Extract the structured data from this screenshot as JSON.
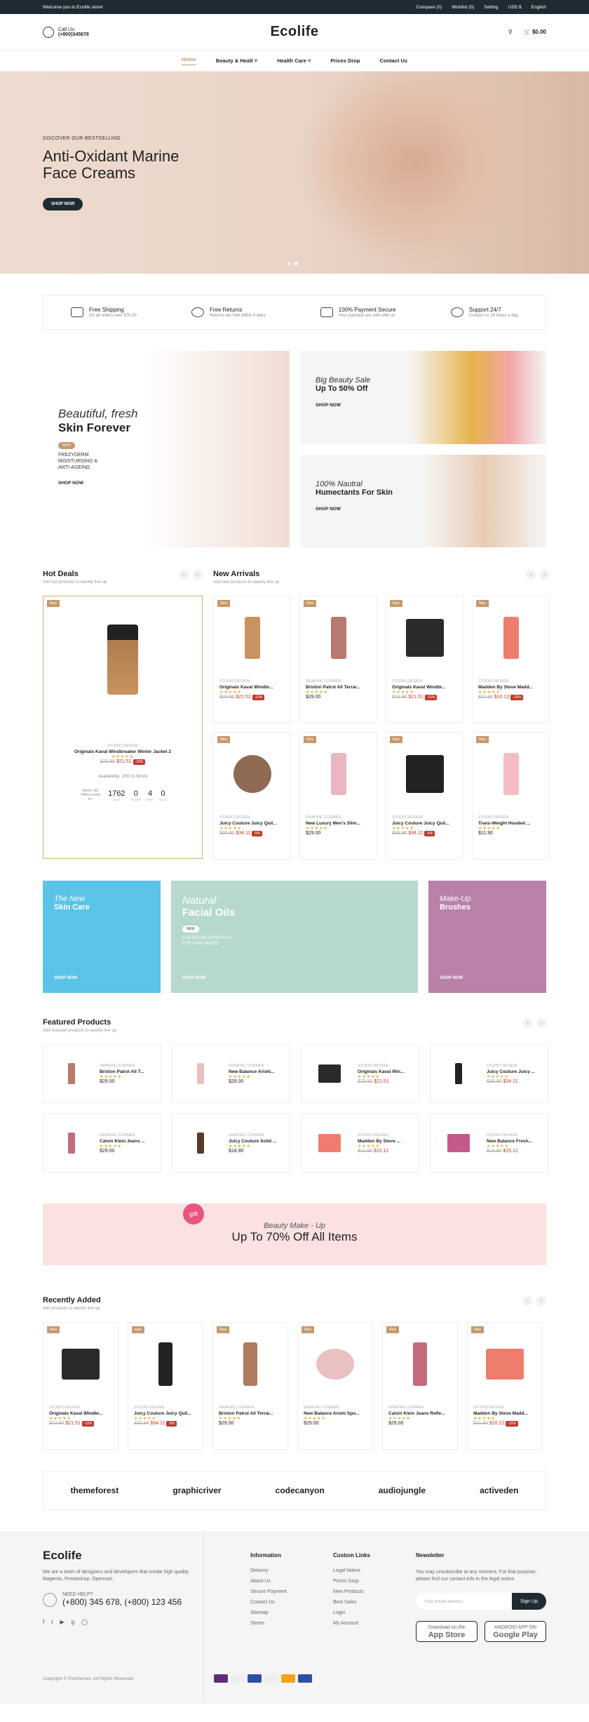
{
  "topbar": {
    "welcome": "Welcome you to Ecolife store!",
    "compare": "Compare (0)",
    "wishlist": "Wishlist (0)",
    "setting": "Setting",
    "currency": "USD $",
    "language": "English"
  },
  "header": {
    "call_label": "Call Us:",
    "phone": "(+800)345678",
    "logo": "Ecolife",
    "cart_total": "$0.00",
    "cart_count": "0"
  },
  "nav": [
    "Home",
    "Beauty & Healt",
    "Health Care",
    "Prices Drop",
    "Contact Us"
  ],
  "hero": {
    "eyebrow": "DISCOVER OUR BESTSELLING",
    "title": "Anti-Oxidant Marine Face Creams",
    "button": "SHOP NOW"
  },
  "features": [
    {
      "title": "Free Shipping",
      "sub": "On all orders over $75.00"
    },
    {
      "title": "Free Returns",
      "sub": "Returns are free within 9 days"
    },
    {
      "title": "100% Payment Secure",
      "sub": "Your payment are safe with us."
    },
    {
      "title": "Support 24/7",
      "sub": "Contact us 24 hours a day"
    }
  ],
  "banners": {
    "big": {
      "italic": "Beautiful, fresh",
      "bold": "Skin Forever",
      "tag": "NEW",
      "lines": [
        "FREZYDERM",
        "MOISTURSING &",
        "ANTI-AGEING"
      ],
      "cta": "SHOP NOW"
    },
    "top": {
      "italic": "Big Beauty Sale",
      "bold": "Up To 50% Off",
      "cta": "SHOP NOW"
    },
    "bottom": {
      "italic": "100% Nautral",
      "bold": "Humectants For Skin",
      "cta": "SHOP NOW"
    }
  },
  "hot_deals": {
    "title": "Hot Deals",
    "sub": "Add hot products to weekly line up",
    "badge": "New",
    "meta": "STUDIO DESIGN",
    "name": "Originals Kaval Windbreaker Winter Jacket 2",
    "old": "$23.90",
    "new": "$21.51",
    "disc": "-10%",
    "availability": "Availability: 200 In Stock",
    "hurry": "Hurry Up! Offers ends in:",
    "days": "1762",
    "hours": "0",
    "mins": "4",
    "secs": "0",
    "l_days": "DAYS",
    "l_hours": "HOURS",
    "l_mins": "MINS",
    "l_secs": "SECS"
  },
  "new_arrivals": {
    "title": "New Arrivals",
    "sub": "Add new products to weekly line up",
    "items": [
      {
        "meta": "STUDIO DESIGN",
        "name": "Originals Kaval Windbr...",
        "old": "$23.90",
        "new": "$21.51",
        "disc": "-10%",
        "color": "#c8935e"
      },
      {
        "meta": "GRAPHIC CORNER",
        "name": "Brixton Patrol All Terrai...",
        "price": "$29.00",
        "color": "#b87a6e"
      },
      {
        "meta": "STUDIO DESIGN",
        "name": "Originals Kaval Windbr...",
        "old": "$23.90",
        "new": "$21.51",
        "disc": "-10%",
        "color": "#2a2a2a"
      },
      {
        "meta": "STUDIO DESIGN",
        "name": "Madden By Steve Madd...",
        "old": "$11.90",
        "new": "$10.12",
        "disc": "-15%",
        "color": "#ee7d6e"
      },
      {
        "meta": "STUDIO DESIGN",
        "name": "Juicy Couture Juicy Quil...",
        "old": "$35.90",
        "new": "$34.11",
        "disc": "-5%",
        "color": "#8f6b53"
      },
      {
        "meta": "GRAPHIC CORNER",
        "name": "New Luxury Men's Slim...",
        "price": "$29.00",
        "color": "#e8b7c2"
      },
      {
        "meta": "STUDIO DESIGN",
        "name": "Juicy Couture Juicy Quil...",
        "old": "$35.90",
        "new": "$34.11",
        "disc": "-5%",
        "color": "#222"
      },
      {
        "meta": "STUDIO DESIGN",
        "name": "Trans-Weight Hooded ...",
        "price": "$11.90",
        "color": "#f5bcc6"
      }
    ]
  },
  "promos": [
    {
      "italic": "The New",
      "bold": "Skin Care",
      "cta": "SHOP NOW",
      "color": "#5cc3e8"
    },
    {
      "italic": "Natural",
      "bold": "Facial Oils",
      "tag": "NEW",
      "line1": "A SKINCARE ESSENTIAL",
      "line2": "FOR A BALANCED",
      "cta": "SHOP NOW",
      "color": "#b6d8cf"
    },
    {
      "italic": "Make-Up",
      "bold": "Brushes",
      "cta": "SHOP NOW",
      "color": "#b981a8"
    }
  ],
  "featured": {
    "title": "Featured Products",
    "sub": "Add featured products to weekly line up",
    "items": [
      {
        "meta": "GRAPHIC CORNER",
        "name": "Brixton Patrol All T...",
        "price": "$29.00",
        "color": "#b87a6e"
      },
      {
        "meta": "GRAPHIC CORNER",
        "name": "New Balance Arishi...",
        "price": "$29.00",
        "color": "#e9c1c1"
      },
      {
        "meta": "STUDIO DESIGN",
        "name": "Originals Kaval Win...",
        "old": "$23.90",
        "new": "$21.51",
        "color": "#2a2a2a"
      },
      {
        "meta": "STUDIO DESIGN",
        "name": "Juicy Couture Juicy ...",
        "old": "$35.90",
        "new": "$34.11",
        "color": "#222"
      },
      {
        "meta": "GRAPHIC CORNER",
        "name": "Calvin Klein Jeans ...",
        "price": "$29.00",
        "color": "#c46b7a"
      },
      {
        "meta": "GRAPHIC CORNER",
        "name": "Juicy Couture Solid ...",
        "price": "$18.90",
        "color": "#5a3a2a"
      },
      {
        "meta": "STUDIO DESIGN",
        "name": "Madden By Steve ...",
        "old": "$11.90",
        "new": "$10.12",
        "color": "#ee7d6e"
      },
      {
        "meta": "STUDIO DESIGN",
        "name": "New Balance Fresh...",
        "old": "$18.90",
        "new": "$15.12",
        "color": "#c25a8a"
      }
    ]
  },
  "sale": {
    "gift": "gift",
    "italic": "Beauty Make - Up",
    "bold": "Up To 70% Off All Items"
  },
  "recent": {
    "title": "Recently Added",
    "sub": "Add products to weekly line up",
    "items": [
      {
        "meta": "STUDIO DESIGN",
        "name": "Originals Kaval Windbr...",
        "old": "$23.90",
        "new": "$21.51",
        "disc": "-10%",
        "color": "#2a2a2a"
      },
      {
        "meta": "STUDIO DESIGN",
        "name": "Juicy Couture Juicy Quil...",
        "old": "$35.90",
        "new": "$34.11",
        "disc": "-5%",
        "color": "#222"
      },
      {
        "meta": "GRAPHIC CORNER",
        "name": "Brixton Patrol All Terrai...",
        "price": "$29.00",
        "color": "#b07a5e"
      },
      {
        "meta": "GRAPHIC CORNER",
        "name": "New Balance Arishi Spo...",
        "price": "$29.00",
        "color": "#e9c1c1"
      },
      {
        "meta": "GRAPHIC CORNER",
        "name": "Calvin Klein Jeans Refle...",
        "price": "$29.00",
        "color": "#c46b7a"
      },
      {
        "meta": "STUDIO DESIGN",
        "name": "Madden By Steve Madd...",
        "old": "$11.90",
        "new": "$10.12",
        "disc": "-15%",
        "color": "#ee7d6e"
      }
    ]
  },
  "brands": [
    "themeforest",
    "graphicriver",
    "codecanyon",
    "audiojungle",
    "activeden"
  ],
  "footer": {
    "logo": "Ecolife",
    "about": "We are a team of designers and developers that create high quality Magento, Prestashop, Opencart.",
    "need": "NEED HELP?",
    "phones": "(+800) 345 678, (+800) 123 456",
    "info_title": "Information",
    "info": [
      "Delivery",
      "About Us",
      "Secure Payment",
      "Contact Us",
      "Sitemap",
      "Stores"
    ],
    "links_title": "Custom Links",
    "links": [
      "Legal Notice",
      "Prices Drop",
      "New Products",
      "Best Sales",
      "Login",
      "My Account"
    ],
    "news_title": "Newsletter",
    "news_text": "You may unsubscribe at any moment. For that purpose, please find our contact info in the legal notice.",
    "email_ph": "Your email address",
    "signup": "Sign Up",
    "appstore_small": "Download on the",
    "appstore": "App Store",
    "gplay_small": "ANDROID APP ON",
    "gplay": "Google Play",
    "copyright": "Copyright © Posthemes. All Rights Reserved"
  }
}
